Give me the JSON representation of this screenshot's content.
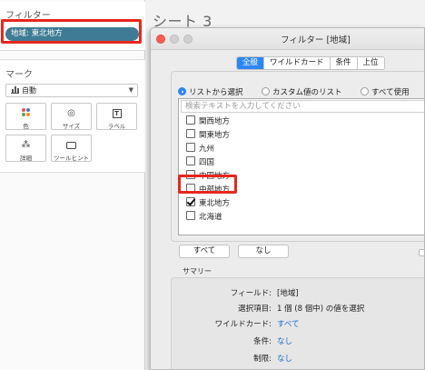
{
  "sidebar": {
    "filters": {
      "title": "フィルター",
      "pill": "地域: 東北地方"
    },
    "marks": {
      "title": "マーク",
      "type": "自動",
      "buttons": [
        {
          "label": "色",
          "icon": "color-dots-icon"
        },
        {
          "label": "サイズ",
          "icon": "size-icon"
        },
        {
          "label": "ラベル",
          "icon": "label-icon"
        },
        {
          "label": "詳細",
          "icon": "detail-icon"
        },
        {
          "label": "ツールヒント",
          "icon": "tooltip-icon"
        }
      ]
    }
  },
  "sheet": {
    "title": "シート 3"
  },
  "dialog": {
    "title": "フィルター [地域]",
    "tabs": [
      "全般",
      "ワイルドカード",
      "条件",
      "上位"
    ],
    "active_tab": "全般",
    "radios": [
      {
        "label": "リストから選択",
        "checked": true
      },
      {
        "label": "カスタム値のリスト",
        "checked": false
      },
      {
        "label": "すべて使用",
        "checked": false
      }
    ],
    "search_placeholder": "検索テキストを入力してください",
    "items": [
      {
        "label": "関西地方",
        "checked": false
      },
      {
        "label": "関東地方",
        "checked": false
      },
      {
        "label": "九州",
        "checked": false
      },
      {
        "label": "四国",
        "checked": false
      },
      {
        "label": "中国地方",
        "checked": false
      },
      {
        "label": "中部地方",
        "checked": false
      },
      {
        "label": "東北地方",
        "checked": true
      },
      {
        "label": "北海道",
        "checked": false
      }
    ],
    "buttons": {
      "all": "すべて",
      "none": "なし"
    },
    "summary": {
      "title": "サマリー",
      "rows": [
        {
          "label": "フィールド:",
          "value": "[地域]",
          "link": false
        },
        {
          "label": "選択項目:",
          "value": "1 個 (8 個中) の値を選択",
          "link": false
        },
        {
          "label": "ワイルドカード:",
          "value": "すべて",
          "link": true
        },
        {
          "label": "条件:",
          "value": "なし",
          "link": true
        },
        {
          "label": "制限:",
          "value": "なし",
          "link": true
        }
      ]
    }
  },
  "colors": {
    "accent": "#2e86f5",
    "pill": "#3f7b94",
    "highlight": "#e8271d",
    "link": "#1a6ad4"
  }
}
